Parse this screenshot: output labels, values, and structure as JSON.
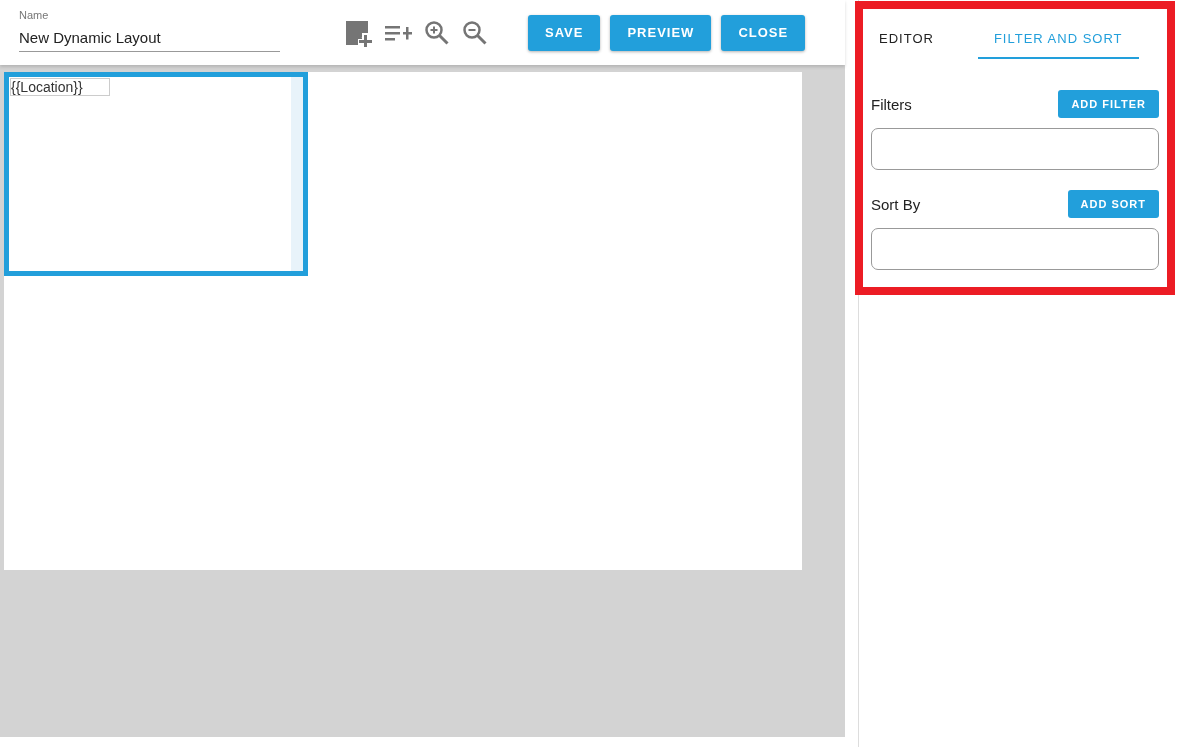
{
  "name_field": {
    "label": "Name",
    "value": "New Dynamic Layout"
  },
  "actions": [
    "SAVE",
    "PREVIEW",
    "CLOSE"
  ],
  "canvas": {
    "element_text": "{{Location}}"
  },
  "tabs": [
    {
      "label": "EDITOR",
      "selected": false
    },
    {
      "label": "FILTER AND SORT",
      "selected": true
    }
  ],
  "sections": [
    {
      "label": "Filters",
      "button": "ADD FILTER"
    },
    {
      "label": "Sort By",
      "button": "ADD SORT"
    }
  ]
}
